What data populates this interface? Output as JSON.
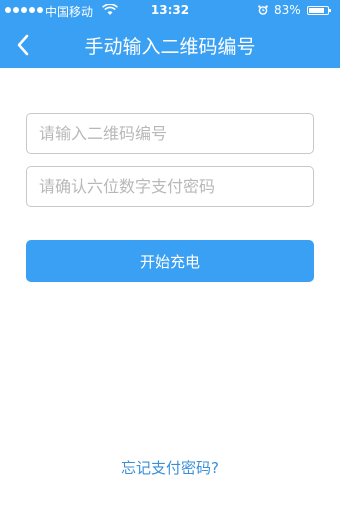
{
  "status_bar": {
    "carrier": "中国移动",
    "time": "13:32",
    "battery": "83%",
    "battery_level": 0.83,
    "signal_dots": 5
  },
  "nav": {
    "title": "手动输入二维码编号",
    "back_icon": "chevron-left-icon"
  },
  "form": {
    "qr_code": {
      "value": "",
      "placeholder": "请输入二维码编号"
    },
    "payment_password": {
      "value": "",
      "placeholder": "请确认六位数字支付密码"
    },
    "submit_label": "开始充电"
  },
  "forgot_password_link": "忘记支付密码?",
  "colors": {
    "primary": "#3aa0f3",
    "link": "#3a8fd8",
    "border": "#c8c8c8",
    "placeholder": "#b8b8b8"
  }
}
